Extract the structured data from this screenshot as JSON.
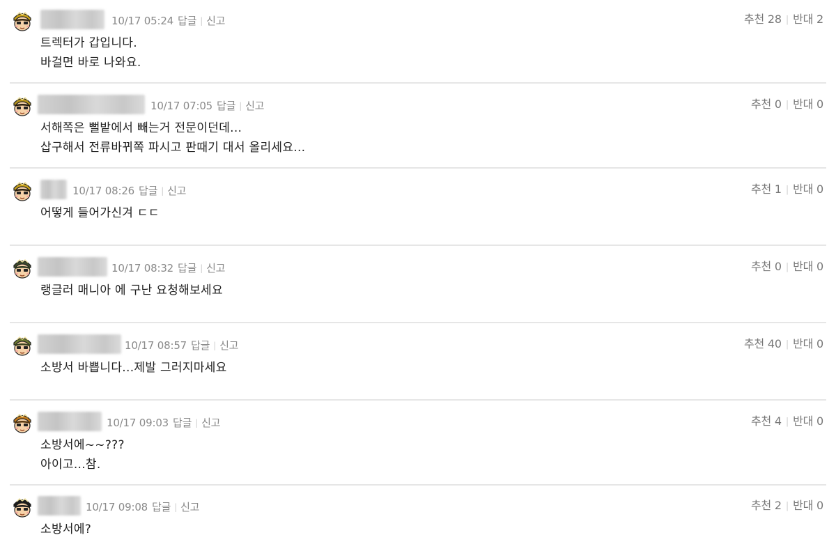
{
  "labels": {
    "reply": "답글",
    "report": "신고",
    "recommend": "추천",
    "oppose": "반대"
  },
  "comments": [
    {
      "avatar_icon": "character-avatar-icon",
      "avatar_hair": "#3b2a12",
      "avatar_hat": "#c9a21a",
      "time": "10/17 05:24",
      "recommend": "28",
      "oppose": "2",
      "lines": [
        "트렉터가 갑입니다.",
        "바걸면 바로 나와요."
      ]
    },
    {
      "avatar_icon": "character-avatar-icon",
      "avatar_hair": "#2b2110",
      "avatar_hat": "#b8951b",
      "time": "10/17 07:05",
      "recommend": "0",
      "oppose": "0",
      "lines": [
        "서해쪽은 뻘밭에서 빼는거 전문이던데...",
        "삽구해서 전류바뀌쪽 파시고 판때기 대서 올리세요..."
      ]
    },
    {
      "avatar_icon": "character-avatar-icon",
      "avatar_hair": "#2b2110",
      "avatar_hat": "#c9a21a",
      "time": "10/17 08:26",
      "recommend": "1",
      "oppose": "0",
      "lines": [
        "어떻게 들어가신겨 ㄷㄷ"
      ]
    },
    {
      "avatar_icon": "character-avatar-icon",
      "avatar_hair": "#2f3a22",
      "avatar_hat": "#3d4a2a",
      "time": "10/17 08:32",
      "recommend": "0",
      "oppose": "0",
      "lines": [
        "랭글러 매니아 에 구난 요청해보세요"
      ]
    },
    {
      "avatar_icon": "character-avatar-icon",
      "avatar_hair": "#3a4420",
      "avatar_hat": "#6b7a2e",
      "time": "10/17 08:57",
      "recommend": "40",
      "oppose": "0",
      "lines": [
        "소방서 바쁩니다...제발 그러지마세요"
      ]
    },
    {
      "avatar_icon": "character-avatar-icon",
      "avatar_hair": "#5a3a12",
      "avatar_hat": "#c47a1a",
      "time": "10/17 09:03",
      "recommend": "4",
      "oppose": "0",
      "lines": [
        "소방서에~~???",
        "아이고...참."
      ]
    },
    {
      "avatar_icon": "character-avatar-icon",
      "avatar_hair": "#1a1a1a",
      "avatar_hat": "#1a1a1a",
      "time": "10/17 09:08",
      "recommend": "2",
      "oppose": "0",
      "lines": [
        "소방서에?"
      ]
    }
  ]
}
